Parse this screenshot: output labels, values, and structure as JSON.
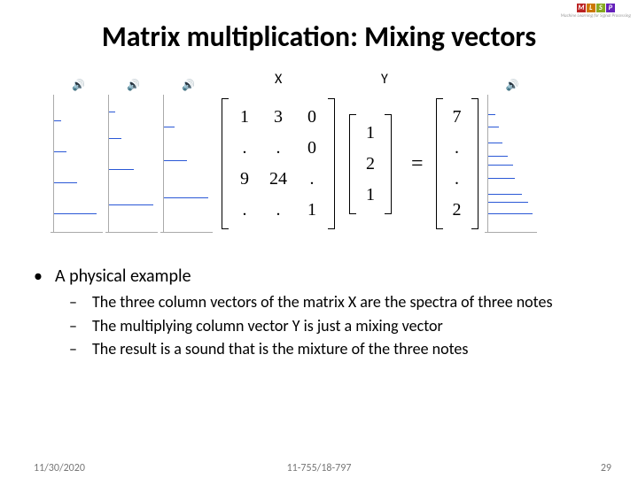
{
  "logo": {
    "letters": [
      "M",
      "L",
      "S",
      "P"
    ]
  },
  "title": "Matrix multiplication: Mixing vectors",
  "figure": {
    "labelX": "X",
    "labelY": "Y",
    "eq": "=",
    "speaker_glyph": "🔊",
    "matrixX": [
      [
        "1",
        "3",
        "0"
      ],
      [
        ".",
        ".",
        "0"
      ],
      [
        "9",
        "24",
        "."
      ],
      [
        ".",
        ".",
        "1"
      ]
    ],
    "vectorY": [
      "1",
      "2",
      "1"
    ],
    "result": [
      "7",
      ".",
      ".",
      "2"
    ]
  },
  "bullet": "A physical example",
  "subs": [
    "The three column vectors of the matrix X are the spectra of three notes",
    "The multiplying column vector Y is just a mixing vector",
    "The result is a sound that is the mixture of the three notes"
  ],
  "footer": {
    "date": "11/30/2020",
    "course": "11-755/18-797",
    "page": "29"
  }
}
